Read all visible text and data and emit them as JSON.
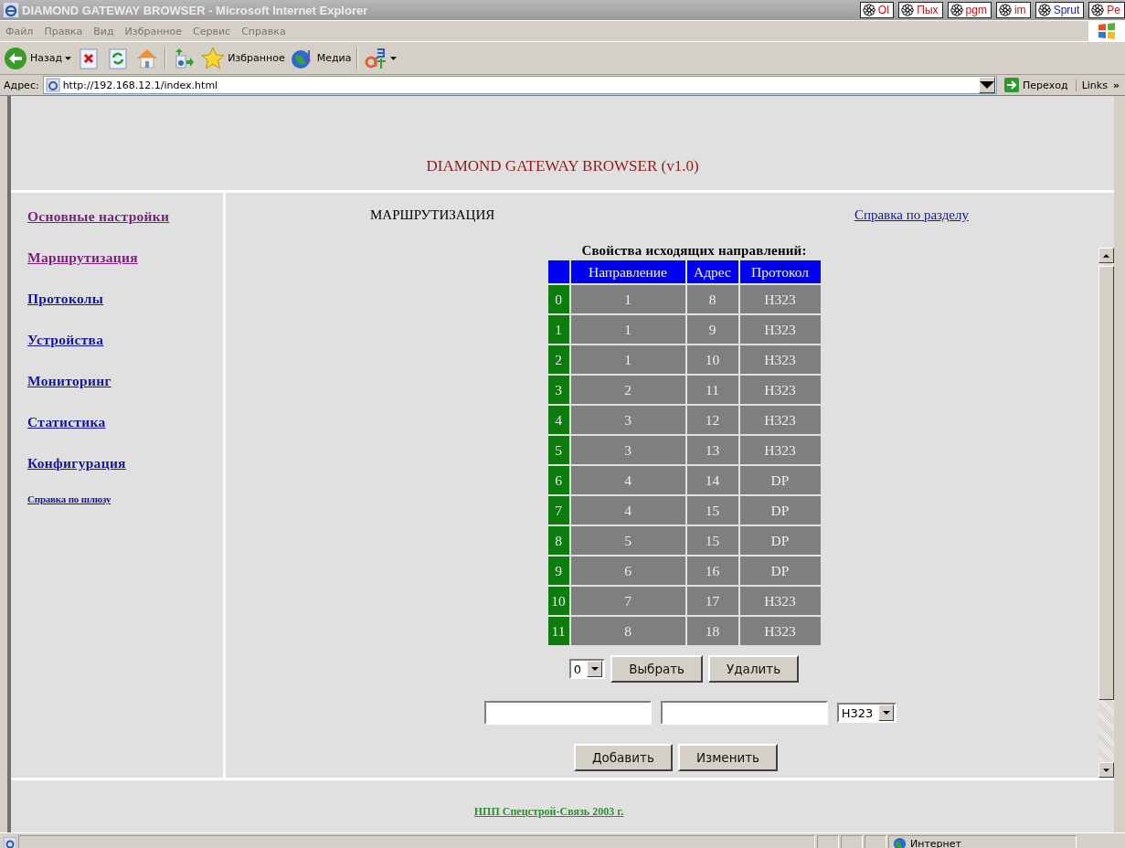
{
  "window": {
    "title": "DIAMOND GATEWAY BROWSER - Microsoft Internet Explorer"
  },
  "quick_launch": [
    {
      "label": "OI",
      "color": "#cc1111"
    },
    {
      "label": "Пых",
      "color": "#cc1111"
    },
    {
      "label": "pgm",
      "color": "#cc1111"
    },
    {
      "label": "im",
      "color": "#cc1111"
    },
    {
      "label": "Sprut",
      "color": "#22229a"
    },
    {
      "label": "Pe",
      "color": "#cc1111"
    }
  ],
  "menu": [
    "Файл",
    "Правка",
    "Вид",
    "Избранное",
    "Сервис",
    "Справка"
  ],
  "toolbar": [
    {
      "kind": "back",
      "label": "Назад"
    },
    {
      "kind": "stop"
    },
    {
      "kind": "refresh"
    },
    {
      "kind": "home"
    },
    {
      "kind": "separator"
    },
    {
      "kind": "send"
    },
    {
      "kind": "favorites",
      "label": "Избранное"
    },
    {
      "kind": "media",
      "label": "Медиа"
    },
    {
      "kind": "separator"
    },
    {
      "kind": "translate"
    }
  ],
  "address": {
    "label": "Адрес:",
    "url": "http://192.168.12.1/index.html",
    "go": "Переход",
    "links": "Links",
    "more": "»"
  },
  "page": {
    "header": "DIAMOND GATEWAY BROWSER (v1.0)",
    "nav": [
      {
        "label": "Основные настройки",
        "visited": true,
        "kind": "normal"
      },
      {
        "label": "Маршрутизация",
        "visited": true,
        "kind": "normal"
      },
      {
        "label": "Протоколы",
        "visited": false,
        "kind": "normal"
      },
      {
        "label": "Устройства",
        "visited": false,
        "kind": "normal"
      },
      {
        "label": "Мониторинг",
        "visited": false,
        "kind": "normal"
      },
      {
        "label": "Статистика",
        "visited": false,
        "kind": "normal"
      },
      {
        "label": "Конфигурация",
        "visited": false,
        "kind": "normal"
      },
      {
        "label": "Справка по шлюзу",
        "visited": false,
        "kind": "small"
      }
    ],
    "section_title": "МАРШРУТИЗАЦИЯ",
    "help_link": "Справка по разделу",
    "table": {
      "caption": "Свойства исходящих направлений:",
      "columns": [
        "Направление",
        "Адрес",
        "Протокол"
      ],
      "rows": [
        {
          "index": "0",
          "cells": [
            "1",
            "8",
            "H323"
          ]
        },
        {
          "index": "1",
          "cells": [
            "1",
            "9",
            "H323"
          ]
        },
        {
          "index": "2",
          "cells": [
            "1",
            "10",
            "H323"
          ]
        },
        {
          "index": "3",
          "cells": [
            "2",
            "11",
            "H323"
          ]
        },
        {
          "index": "4",
          "cells": [
            "3",
            "12",
            "H323"
          ]
        },
        {
          "index": "5",
          "cells": [
            "3",
            "13",
            "H323"
          ]
        },
        {
          "index": "6",
          "cells": [
            "4",
            "14",
            "DP"
          ]
        },
        {
          "index": "7",
          "cells": [
            "4",
            "15",
            "DP"
          ]
        },
        {
          "index": "8",
          "cells": [
            "5",
            "15",
            "DP"
          ]
        },
        {
          "index": "9",
          "cells": [
            "6",
            "16",
            "DP"
          ]
        },
        {
          "index": "10",
          "cells": [
            "7",
            "17",
            "H323"
          ]
        },
        {
          "index": "11",
          "cells": [
            "8",
            "18",
            "H323"
          ]
        }
      ]
    },
    "row_select": "0",
    "row_buttons": [
      "Выбрать",
      "Удалить"
    ],
    "new_entry": {
      "fields": [
        {
          "kind": "text"
        },
        {
          "kind": "text"
        }
      ],
      "protocol": "H323"
    },
    "entry_buttons": [
      "Добавить",
      "Изменить"
    ],
    "footer": "НПП Спецстрой-Связь 2003 г."
  },
  "status_bar": {
    "zone": "Интернет"
  }
}
